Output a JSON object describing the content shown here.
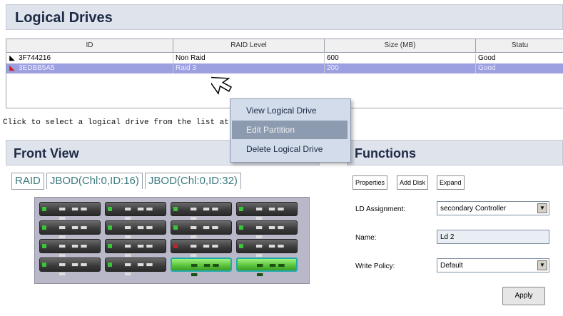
{
  "logical_drives": {
    "title": "Logical Drives",
    "columns": [
      "ID",
      "RAID Level",
      "Size (MB)",
      "Statu"
    ],
    "rows": [
      {
        "id": "3F744216",
        "raid": "Non Raid",
        "size": "600",
        "status": "Good"
      },
      {
        "id": "3EDBB5A5",
        "raid": "Raid 3",
        "size": "200",
        "status": "Good",
        "selected": true
      }
    ],
    "hint": "Click to select a logical drive from the list at"
  },
  "context_menu": {
    "items": [
      "View Logical Drive",
      "Edit Partition",
      "Delete Logical Drive"
    ],
    "hovered_index": 1
  },
  "front_view": {
    "title": "Front View",
    "tabs": [
      "RAID",
      "JBOD(Chl:0,ID:16)",
      "JBOD(Chl:0,ID:32)"
    ],
    "drive_glyph": "▬ ▬▬ ▬"
  },
  "functions": {
    "title": "Functions",
    "tabs": [
      "Properties",
      "Add Disk",
      "Expand"
    ],
    "ld_assignment_label": "LD Assignment:",
    "ld_assignment_value": "secondary Controller",
    "name_label": "Name:",
    "name_value": "Ld 2",
    "write_policy_label": "Write Policy:",
    "write_policy_value": "Default",
    "apply_label": "Apply"
  },
  "colors": {
    "selected_row": "#9c9fe0",
    "menu_bg": "#d3dceb",
    "menu_hover": "#8c9bb0",
    "title_bg": "#dfe3ec",
    "drive_green": "#58c13a"
  },
  "icons": [
    "drive-row-icon",
    "dropdown-arrow-icon",
    "pointer-cursor-icon"
  ]
}
